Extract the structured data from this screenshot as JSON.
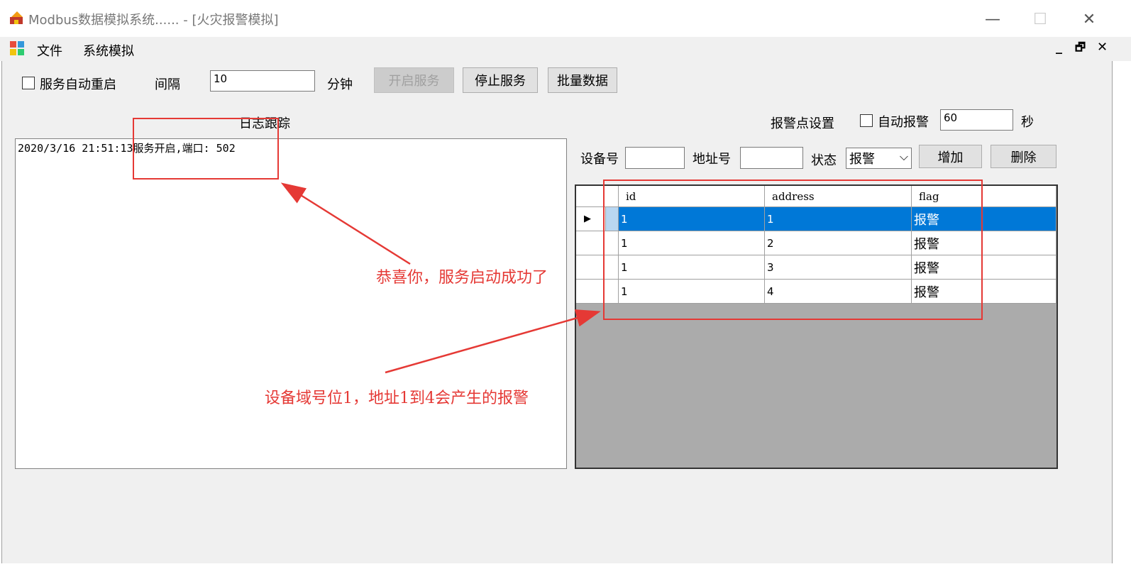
{
  "window": {
    "title": "Modbus数据模拟系统...... - [火灾报警模拟]",
    "minimize": "—",
    "maximize": "☐",
    "close": "✕"
  },
  "menu": {
    "items": [
      "文件",
      "系统模拟"
    ],
    "mdi_minimize": "_",
    "mdi_restore": "🗗",
    "mdi_close": "✕"
  },
  "toolbar": {
    "auto_restart_label": "服务自动重启",
    "auto_restart_checked": false,
    "interval_label": "间隔",
    "interval_value": "10",
    "interval_unit": "分钟",
    "start_button": "开启服务",
    "stop_button": "停止服务",
    "batch_button": "批量数据"
  },
  "log": {
    "title": "日志跟踪",
    "lines": [
      "2020/3/16 21:51:13服务开启,端口: 502"
    ]
  },
  "alarm": {
    "title": "报警点设置",
    "auto_alarm_label": "自动报警",
    "auto_alarm_checked": false,
    "auto_alarm_value": "60",
    "auto_alarm_unit": "秒",
    "device_label": "设备号",
    "device_value": "",
    "address_label": "地址号",
    "address_value": "",
    "state_label": "状态",
    "state_value": "报警",
    "add_button": "增加",
    "delete_button": "删除"
  },
  "grid": {
    "columns": [
      "id",
      "address",
      "flag"
    ],
    "rows": [
      [
        "1",
        "1",
        "报警"
      ],
      [
        "1",
        "2",
        "报警"
      ],
      [
        "1",
        "3",
        "报警"
      ],
      [
        "1",
        "4",
        "报警"
      ]
    ],
    "selected_row": 0
  },
  "annotations": {
    "note1": "恭喜你，服务启动成功了",
    "note2": "设备域号位1，地址1到4会产生的报警"
  },
  "colors": {
    "selection": "#0078d7",
    "annotation": "#e53935"
  }
}
